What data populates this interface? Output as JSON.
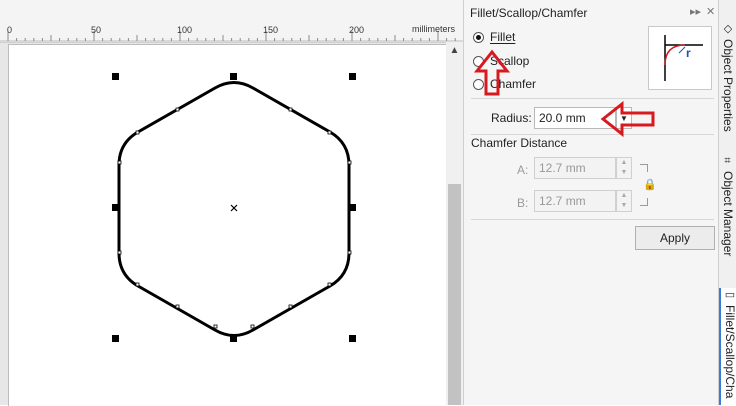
{
  "ruler": {
    "ticks": [
      "0",
      "50",
      "100",
      "150",
      "200"
    ],
    "unit": "millimeters"
  },
  "docker": {
    "title": "Fillet/Scallop/Chamfer",
    "controls": [
      "▸▸",
      "✕"
    ],
    "options": [
      {
        "label": "Fillet",
        "selected": true
      },
      {
        "label": "Scallop",
        "selected": false
      },
      {
        "label": "Chamfer",
        "selected": false
      }
    ],
    "preview_glyph": "r",
    "radius": {
      "label": "Radius:",
      "value": "20.0 mm"
    },
    "chamfer": {
      "heading": "Chamfer Distance",
      "a_label": "A:",
      "a_value": "12.7 mm",
      "b_label": "B:",
      "b_value": "12.7 mm"
    },
    "apply_label": "Apply"
  },
  "side_tabs": [
    {
      "label": "Object Properties",
      "icon": "object-properties-icon"
    },
    {
      "label": "Object Manager",
      "icon": "object-manager-icon"
    },
    {
      "label": "Fillet/Scallop/Cha",
      "icon": "fillet-icon"
    }
  ],
  "colors": {
    "accent": "#3c78d8",
    "arrow": "#d71920",
    "panel": "#f5f5f5"
  }
}
